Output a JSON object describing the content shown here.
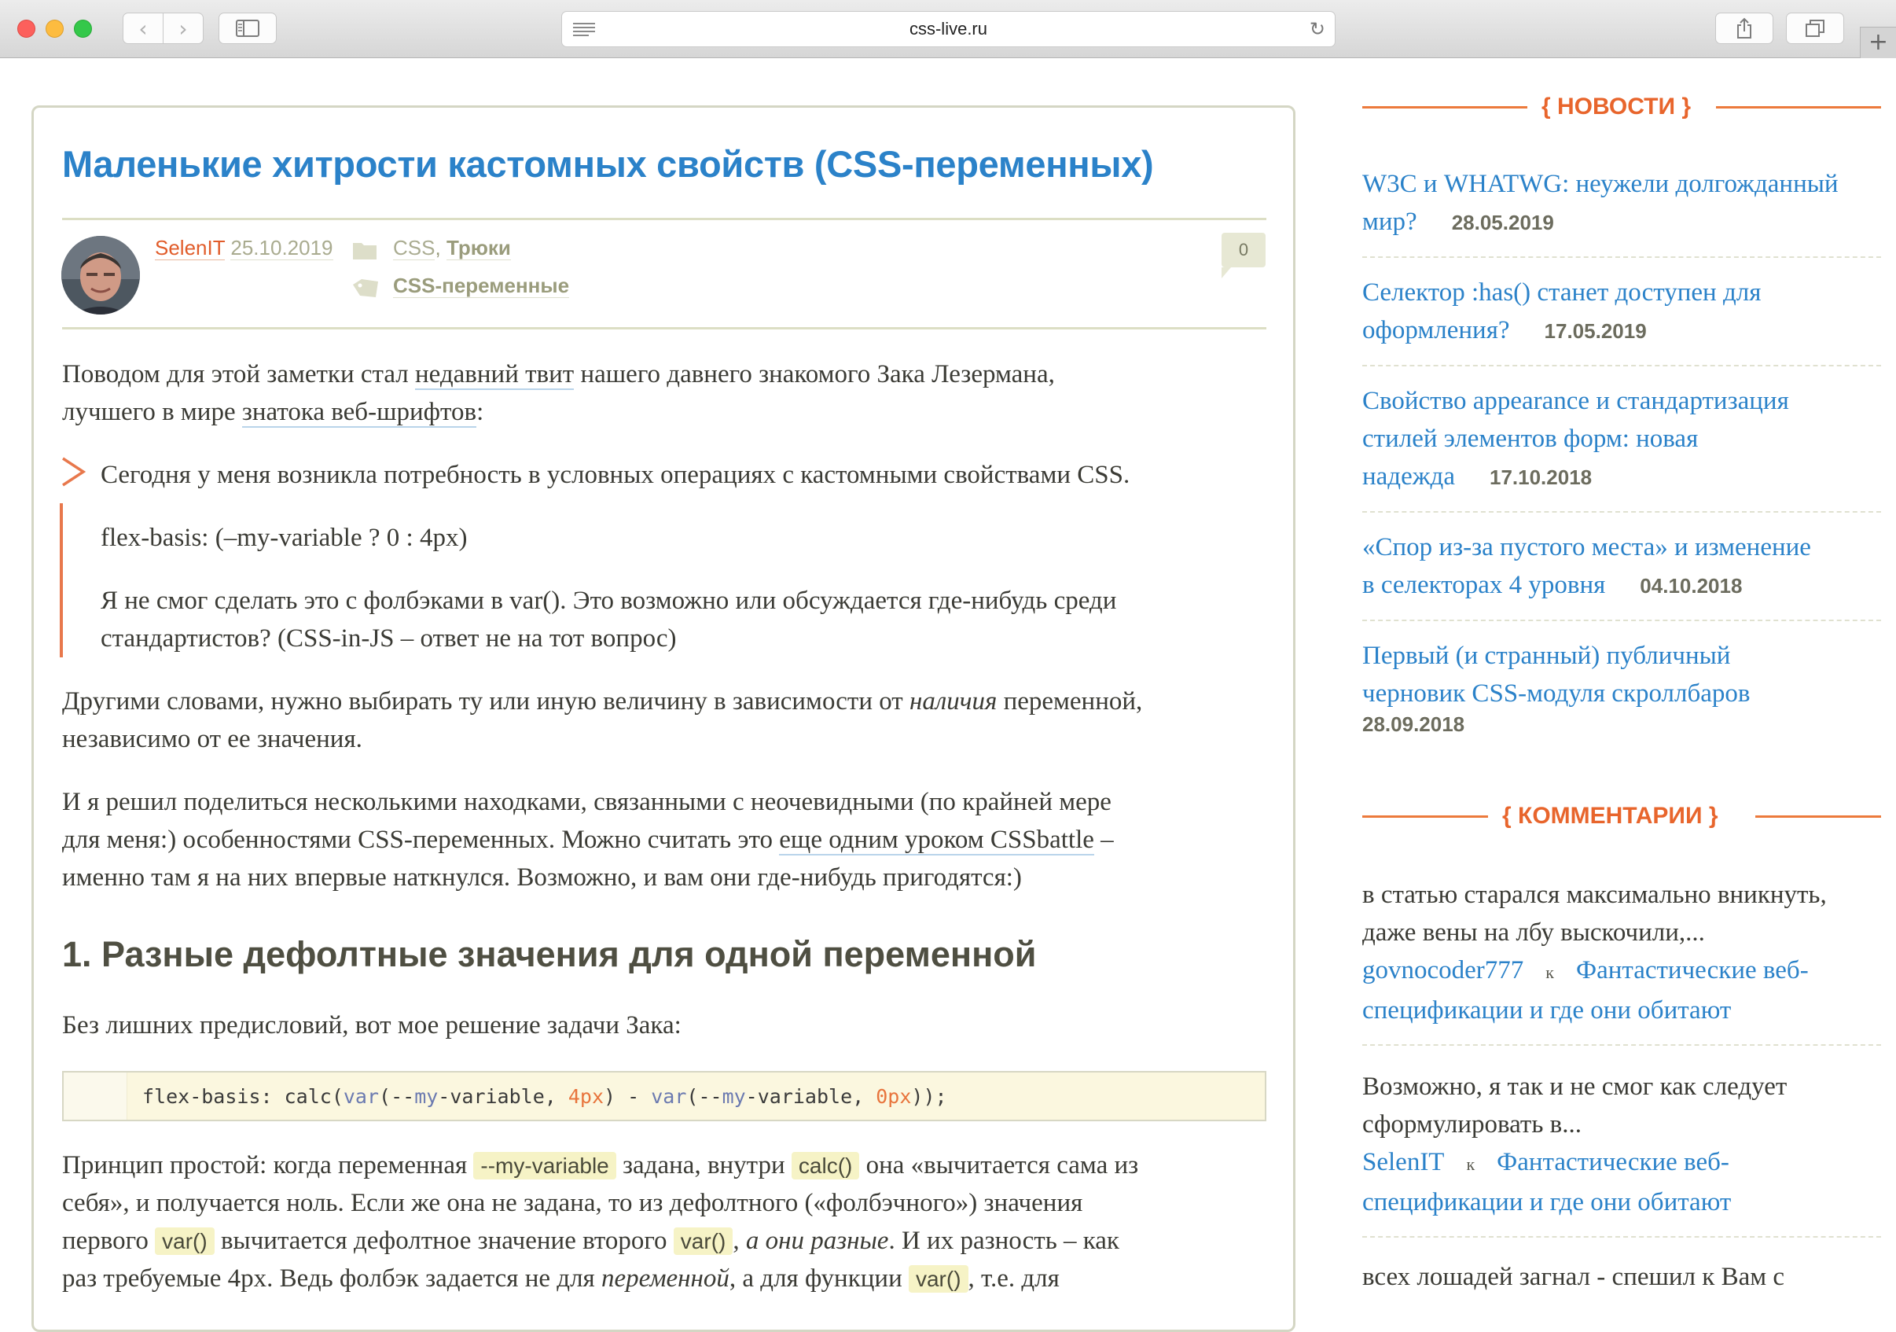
{
  "browser": {
    "url": "css-live.ru",
    "back_icon": "‹",
    "forward_icon": "›",
    "reload_icon": "↻",
    "new_tab_icon": "+"
  },
  "article": {
    "title": "Маленькие хитрости кастомных свойств (CSS-переменных)",
    "author": "SelenIT",
    "date": "25.10.2019",
    "categories": [
      "CSS",
      "Трюки"
    ],
    "category_separator": ",",
    "tag": "CSS-переменные",
    "comments_count": "0",
    "intro": {
      "line1_pre": "Поводом для этой заметки стал ",
      "line1_link": "недавний твит",
      "line1_post": " нашего давнего знакомого Зака Лезермана,",
      "line2_pre": "лучшего в мире ",
      "line2_link": "знатока веб-шрифтов",
      "line2_post": ":"
    },
    "quote": {
      "line1": "Сегодня у меня возникла потребность в условных операциях с кастомными свойствами CSS.",
      "line2": "flex-basis: (–my-variable ? 0 : 4px)",
      "line3": "Я не смог сделать это с фолбэками в var(). Это возможно или обсуждается где-нибудь среди",
      "line4": "стандартистов? (CSS-in-JS – ответ не на тот вопрос)"
    },
    "p2": {
      "line1_pre": "Другими словами, нужно выбирать ту или иную величину в зависимости от ",
      "line1_em": "наличия",
      "line1_post": " переменной,",
      "line2": "независимо от ее значения."
    },
    "p3": {
      "line1": "И я решил поделиться несколькими находками, связанными с неочевидными (по крайней мере",
      "line2_pre": "для меня:) особенностями CSS-переменных. Можно считать это ",
      "line2_link": "еще одним уроком CSSbattle",
      "line2_post": " –",
      "line3": "именно там я на них впервые наткнулся. Возможно, и вам они где-нибудь пригодятся:)"
    },
    "heading1": "1. Разные дефолтные значения для одной переменной",
    "p4": "Без лишних предисловий, вот мое решение задачи Зака:",
    "code": {
      "t1": "flex-basis: calc(",
      "f1": "var",
      "t2": "(--",
      "f2": "my",
      "t3": "-variable, ",
      "n1": "4px",
      "t4": ") - ",
      "f3": "var",
      "t5": "(--",
      "f4": "my",
      "t6": "-variable, ",
      "n2": "0px",
      "t7": "));"
    },
    "p5": {
      "l1_a": "Принцип простой: когда переменная ",
      "l1_code1": "--my-variable",
      "l1_b": " задана, внутри ",
      "l1_code2": "calc()",
      "l1_c": " она «вычитается сама из",
      "l2": "себя», и получается ноль. Если же она не задана, то из дефолтного («фолбэчного») значения",
      "l3_a": "первого ",
      "l3_code1": "var()",
      "l3_b": " вычитается дефолтное значение второго ",
      "l3_code2": "var()",
      "l3_c": ", ",
      "l3_em": "а они разные",
      "l3_d": ". И их разность – как",
      "l4_a": "раз требуемые 4px. Ведь фолбэк задается не для ",
      "l4_em": "переменной",
      "l4_b": ", а для функции ",
      "l4_code": "var()",
      "l4_c": ", т.е. для"
    }
  },
  "sidebar": {
    "news_header": "{ НОВОСТИ }",
    "news": [
      {
        "l1": "W3C и WHATWG: неужели долгожданный",
        "l2": "мир?",
        "date": "28.05.2019"
      },
      {
        "l1": "Селектор :has() станет доступен для",
        "l2": "оформления?",
        "date": "17.05.2019"
      },
      {
        "l1": "Свойство appearance и стандартизация",
        "l2": "стилей элементов форм: новая",
        "l3": "надежда",
        "date": "17.10.2018"
      },
      {
        "l1": "«Спор из-за пустого места» и изменение",
        "l2": "в селекторах 4 уровня",
        "date": "04.10.2018"
      },
      {
        "l1": "Первый (и странный) публичный",
        "l2": "черновик CSS-модуля скроллбаров",
        "date": "28.09.2018"
      }
    ],
    "comments_header": "{ КОММЕНТАРИИ }",
    "comments": [
      {
        "l1": "в статью старался максимально вникнуть,",
        "l2": "даже вены на лбу выскочили,...",
        "author": "govnocoder777",
        "k": "к",
        "a1": "Фантастические веб-",
        "a2": "спецификации и где они обитают"
      },
      {
        "l1": "Возможно, я так и не смог как следует",
        "l2": "сформулировать в...",
        "author": "SelenIT",
        "k": "к",
        "a1": "Фантастические веб-",
        "a2": "спецификации и где они обитают"
      },
      {
        "l1": "всех лошадей загнал - спешил к Вам с"
      }
    ]
  }
}
